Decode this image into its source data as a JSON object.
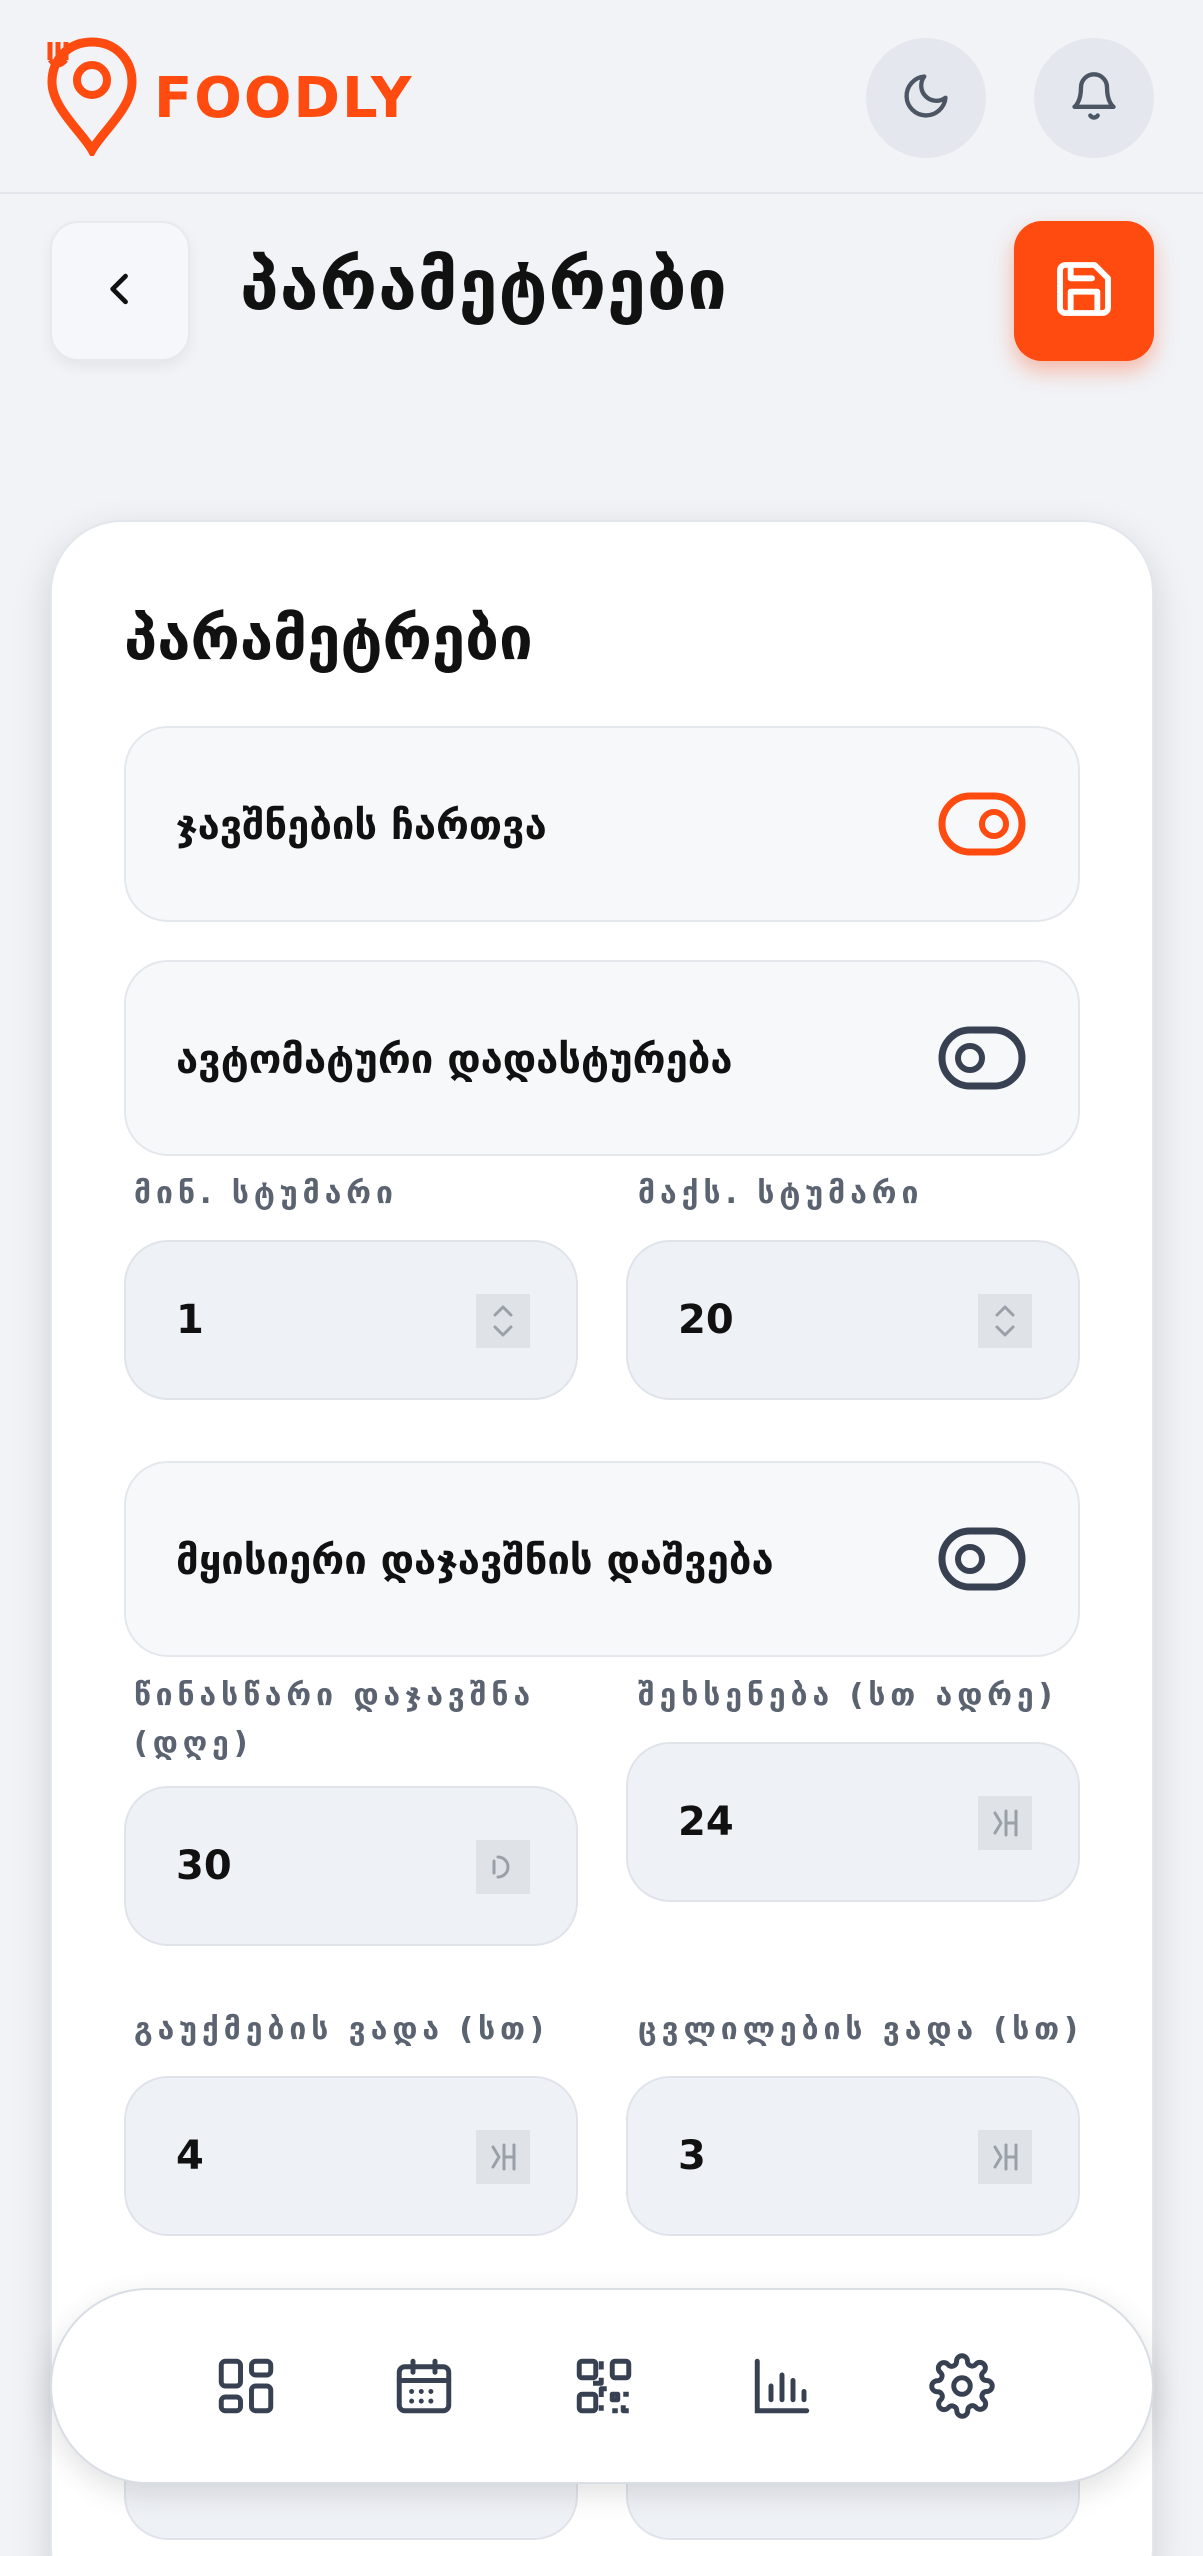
{
  "app": {
    "brand": "FOODLY",
    "brand_color": "#ff4a10"
  },
  "header": {
    "theme_icon": "moon-icon",
    "notifications_icon": "bell-icon"
  },
  "page": {
    "title": "პარამეტრები",
    "back_icon": "chevron-left-icon",
    "save_icon": "save-icon"
  },
  "settings": {
    "title": "პარამეტრები",
    "toggles": [
      {
        "label": "ჯავშნების ჩართვა",
        "on": true
      },
      {
        "label": "ავტომატური დადასტურება",
        "on": false
      },
      {
        "label": "მყისიერი დაჯავშნის დაშვება",
        "on": false
      }
    ],
    "fields": {
      "min_guests": {
        "label": "მინ. სტუმარი",
        "value": "1"
      },
      "max_guests": {
        "label": "მაქს. სტუმარი",
        "value": "20"
      },
      "advance_booking": {
        "label": "წინასწარი დაჯავშნა (დღე)",
        "value": "30"
      },
      "reminder": {
        "label": "შეხსენება (სთ ადრე)",
        "value": "24"
      },
      "cancel_deadline": {
        "label": "გაუქმების ვადა (სთ)",
        "value": "4"
      },
      "change_deadline": {
        "label": "ცვლილების ვადა (სთ)",
        "value": "3"
      }
    }
  },
  "bottom_nav": {
    "items": [
      {
        "icon": "dashboard-grid-icon"
      },
      {
        "icon": "calendar-icon"
      },
      {
        "icon": "qr-code-icon"
      },
      {
        "icon": "bar-chart-icon"
      },
      {
        "icon": "gear-icon",
        "active": true
      }
    ]
  }
}
